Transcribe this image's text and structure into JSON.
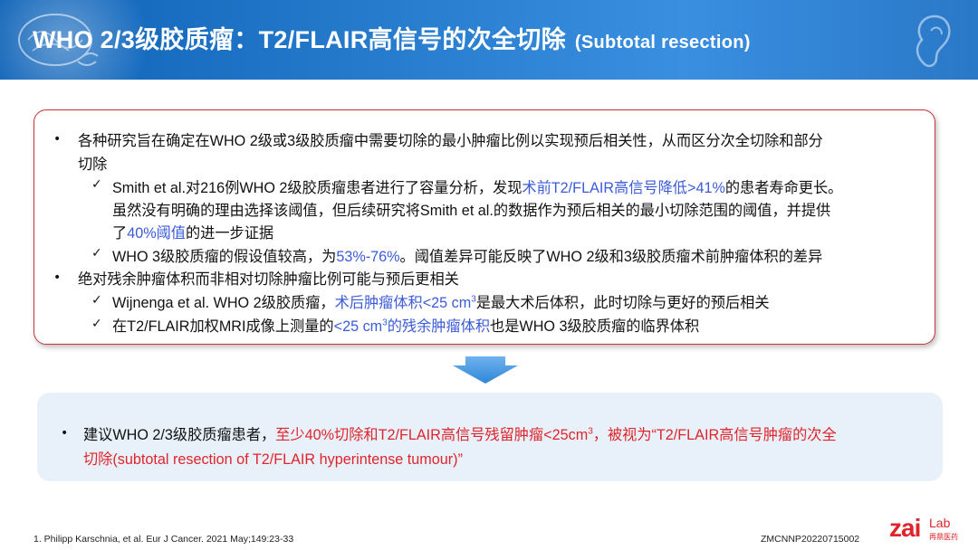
{
  "header": {
    "title": "WHO 2/3级胶质瘤：T2/FLAIR高信号的次全切除",
    "subtitle": "(Subtotal resection)"
  },
  "box1": {
    "b1_l1": "各种研究旨在确定在WHO 2级或3级胶质瘤中需要切除的最小肿瘤比例以实现预后相关性，从而区分次全切除和部分",
    "b1_l2": "切除",
    "c1_pre": "Smith et al.对216例WHO 2级胶质瘤患者进行了容量分析，发现",
    "c1_hl": "术前T2/FLAIR高信号降低>41%",
    "c1_post": "的患者寿命更长。",
    "c1_l2": "虽然没有明确的理由选择该阈值，但后续研究将Smith et al.的数据作为预后相关的最小切除范围的阈值，并提供",
    "c1_l3_pre": "了",
    "c1_l3_hl": "40%阈值",
    "c1_l3_post": "的进一步证据",
    "c2_pre": "WHO 3级胶质瘤的假设值较高，为",
    "c2_hl": "53%-76%",
    "c2_post": "。阈值差异可能反映了WHO 2级和3级胶质瘤术前肿瘤体积的差异",
    "b2": "绝对残余肿瘤体积而非相对切除肿瘤比例可能与预后更相关",
    "c3_pre": "Wijnenga et al. WHO 2级胶质瘤，",
    "c3_hl": "术后肿瘤体积<25 cm",
    "c3_sup": "3",
    "c3_post": "是最大术后体积，此时切除与更好的预后相关",
    "c4_pre": "在T2/FLAIR加权MRI成像上测量的",
    "c4_hl1": "<25 cm",
    "c4_sup": "3",
    "c4_hl2": "的残余肿瘤体积",
    "c4_post": "也是WHO 3级胶质瘤的临界体积"
  },
  "box2": {
    "pre": "建议WHO 2/3级胶质瘤患者，",
    "hl": "至少40%切除和T2/FLAIR高信号残留肿瘤<25cm",
    "sup": "3",
    "hl2": "，被视为“T2/FLAIR高信号肿瘤的次全",
    "l2": "切除(subtotal resection of T2/FLAIR hyperintense tumour)”"
  },
  "footer": {
    "reference": "1.   Philipp Karschnia, et al. Eur J Cancer. 2021 May;149:23-33",
    "code": "ZMCNNP20220715002"
  },
  "logo": {
    "zai": "zai",
    "lab": "Lab",
    "cn": "再鼎医药"
  },
  "colors": {
    "header": "#1f6fc4",
    "highlight_blue": "#3b5bd9",
    "highlight_red": "#e0242b",
    "box_border": "#c9333d"
  }
}
